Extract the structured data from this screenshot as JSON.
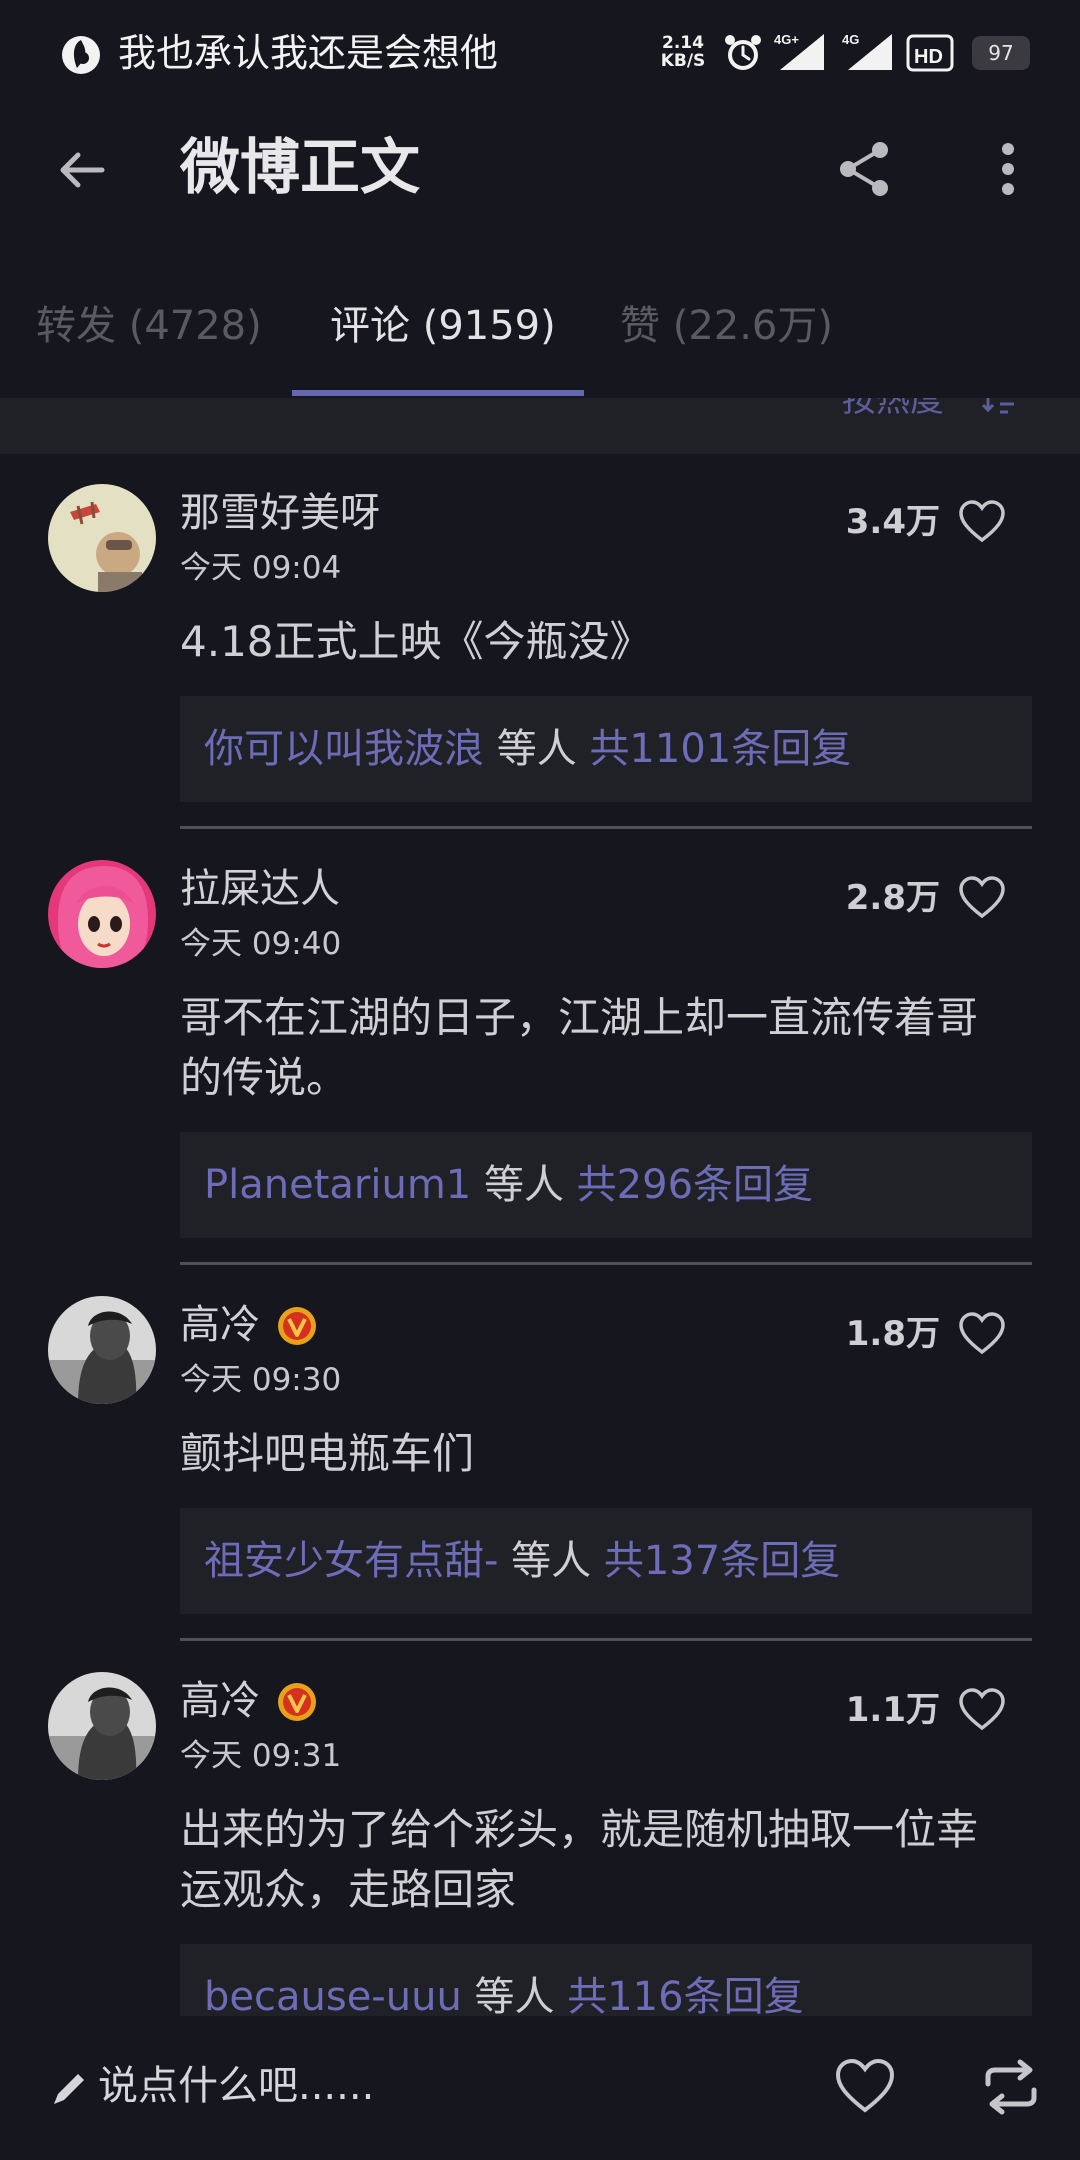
{
  "status_bar": {
    "title": "我也承认我还是会想他",
    "net_speed_value": "2.14",
    "net_speed_unit": "KB/S",
    "signal_1_label": "4G+",
    "signal_2_label": "4G",
    "battery": "97"
  },
  "app_bar": {
    "title": "微博正文"
  },
  "tabs": [
    {
      "label": "转发 (4728)"
    },
    {
      "label": "评论 (9159)"
    },
    {
      "label": "赞 (22.6万)"
    }
  ],
  "sort": {
    "label": "按热度"
  },
  "comments": [
    {
      "username": "那雪好美呀",
      "time": "今天 09:04",
      "likes": "3.4万",
      "content": "4.18正式上映《今瓶没》",
      "reply_name": "你可以叫我波浪",
      "reply_mid": " 等人 ",
      "reply_count": "共1101条回复",
      "verified": false
    },
    {
      "username": "拉屎达人",
      "time": "今天 09:40",
      "likes": "2.8万",
      "content": "哥不在江湖的日子，江湖上却一直流传着哥的传说。",
      "reply_name": "Planetarium1",
      "reply_mid": " 等人 ",
      "reply_count": "共296条回复",
      "verified": false
    },
    {
      "username": "高冷",
      "time": "今天 09:30",
      "likes": "1.8万",
      "content": "颤抖吧电瓶车们",
      "reply_name": "祖安少女有点甜-",
      "reply_mid": " 等人 ",
      "reply_count": "共137条回复",
      "verified": true
    },
    {
      "username": "高冷",
      "time": "今天 09:31",
      "likes": "1.1万",
      "content": "出来的为了给个彩头，就是随机抽取一位幸运观众，走路回家",
      "reply_name": "because-uuu",
      "reply_mid": " 等人 ",
      "reply_count": "共116条回复",
      "verified": true
    }
  ],
  "bottom_bar": {
    "input_placeholder": "说点什么吧......"
  },
  "colors": {
    "background": "#16161e",
    "accent": "#6d6cb6",
    "card": "#202027"
  }
}
